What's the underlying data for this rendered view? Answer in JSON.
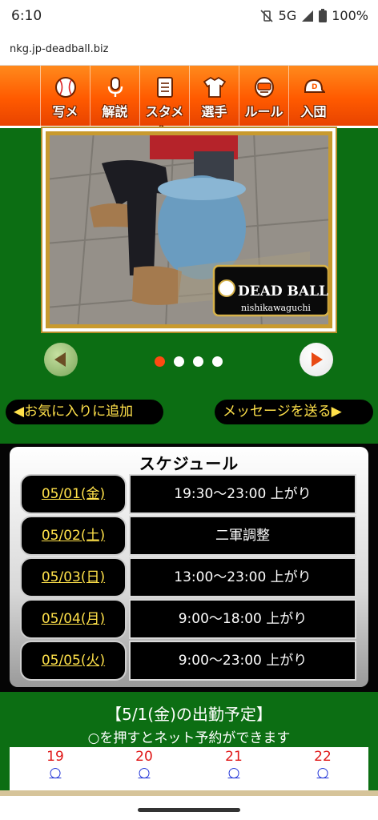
{
  "status": {
    "time": "6:10",
    "network": "5G",
    "battery": "100%"
  },
  "browser": {
    "url": "nkg.jp-deadball.biz"
  },
  "nav": [
    {
      "label": "写メ",
      "icon": "baseball-icon"
    },
    {
      "label": "解説",
      "icon": "microphone-icon"
    },
    {
      "label": "スタメン",
      "icon": "scorecard-icon"
    },
    {
      "label": "選手",
      "icon": "uniform-icon"
    },
    {
      "label": "ルール",
      "icon": "umpire-mask-icon"
    },
    {
      "label": "入団",
      "icon": "cap-icon"
    }
  ],
  "hero": {
    "logo_text": "DEAD BALL",
    "logo_sub": "nishikawaguchi"
  },
  "carousel": {
    "slides": 4,
    "active": 0
  },
  "actions": {
    "favorite": "◀お気に入りに追加",
    "message": "メッセージを送る▶"
  },
  "schedule": {
    "title": "スケジュール",
    "rows": [
      {
        "date": "05/01(金)",
        "time": "19:30〜23:00 上がり"
      },
      {
        "date": "05/02(土)",
        "time": "二軍調整"
      },
      {
        "date": "05/03(日)",
        "time": "13:00〜23:00 上がり"
      },
      {
        "date": "05/04(月)",
        "time": "9:00〜18:00 上がり"
      },
      {
        "date": "05/05(火)",
        "time": "9:00〜23:00 上がり"
      }
    ]
  },
  "attendance": {
    "title": "【5/1(金)の出勤予定】",
    "subtitle": "○を押すとネット予約ができます",
    "days": [
      {
        "day": "19",
        "mark": "○"
      },
      {
        "day": "20",
        "mark": "○"
      },
      {
        "day": "21",
        "mark": "○"
      },
      {
        "day": "22",
        "mark": "○"
      }
    ]
  },
  "colors": {
    "nav_orange": "#ff5a00",
    "field_green": "#0c6e13",
    "pill_text": "#ffe14a",
    "dot_active": "#ff4a12"
  }
}
